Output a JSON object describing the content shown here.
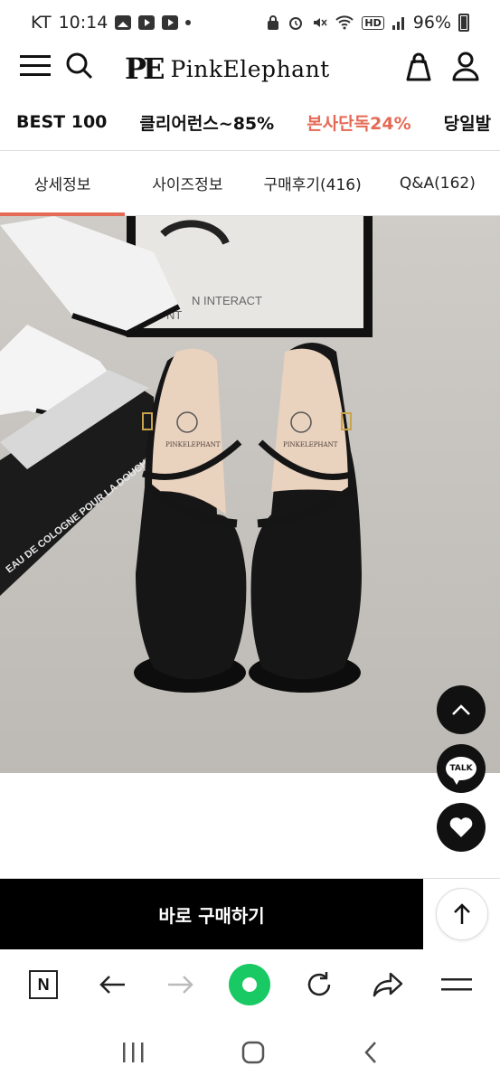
{
  "status_bar": {
    "carrier": "KT",
    "time": "10:14",
    "battery": "96%",
    "hd_label": "HD",
    "left_icons": [
      "gallery-icon",
      "youtube-icon",
      "youtube-icon"
    ],
    "right_icons": [
      "lock-icon",
      "alarm-icon",
      "mute-icon",
      "wifi-icon",
      "signal-icon",
      "battery-icon"
    ]
  },
  "header": {
    "brand_logo": "PE",
    "brand_name": "PinkElephant",
    "icons": [
      "menu-icon",
      "search-icon",
      "bag-icon",
      "user-icon"
    ]
  },
  "category_nav": {
    "items": [
      {
        "label": "BEST 100",
        "accent": false
      },
      {
        "label": "클리어런스~85%",
        "accent": false
      },
      {
        "label": "본사단독24%",
        "accent": true
      },
      {
        "label": "당일발",
        "accent": false
      }
    ],
    "accent_color": "#e56a55"
  },
  "tabs": {
    "items": [
      {
        "label": "상세정보",
        "active": true
      },
      {
        "label": "사이즈정보",
        "active": false
      },
      {
        "label": "구매후기(416)",
        "active": false
      },
      {
        "label": "Q&A(162)",
        "active": false
      }
    ]
  },
  "product_photo": {
    "box_text": "EAU DE COLOGNE POUR LA DOUCHE",
    "poster_text": "N INTERACT",
    "poster_text2": "NT",
    "insole_brand": "PINKELEPHANT"
  },
  "floating": {
    "talk_label": "TALK"
  },
  "buy_bar": {
    "buy_label": "바로 구매하기"
  },
  "browser_toolbar": {
    "n_label": "N"
  }
}
